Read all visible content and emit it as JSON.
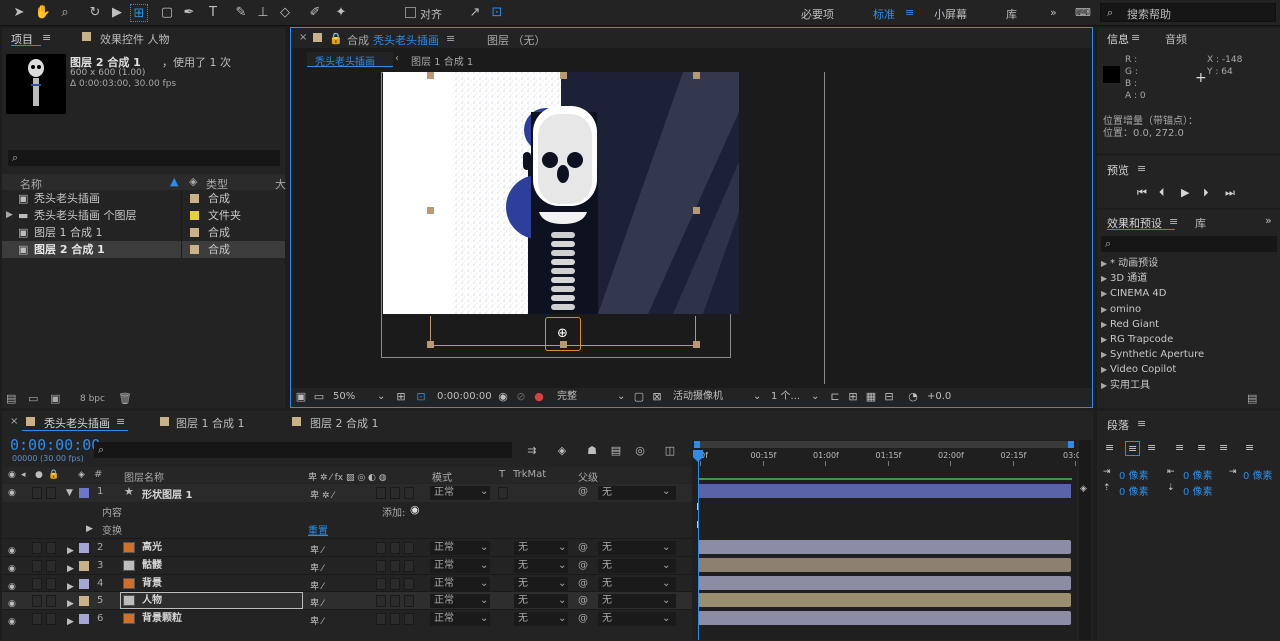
{
  "toolbar": {
    "snap_label": "对齐",
    "workspaces": [
      "必要项",
      "标准",
      "小屏幕",
      "库"
    ],
    "active_workspace": "标准",
    "search_help": "搜索帮助"
  },
  "project": {
    "tab_project": "项目",
    "tab_effects": "效果控件 人物",
    "preview_name": "图层 2 合成 1",
    "preview_used": "，使用了 1 次",
    "preview_size": "600 x 600 (1.00)",
    "preview_duration": "Δ 0:00:03:00, 30.00 fps",
    "col_name": "名称",
    "col_type": "类型",
    "col_size": "大",
    "items": [
      {
        "name": "秃头老头插画",
        "type": "合成",
        "color": "#c8b28a",
        "icon": "comp"
      },
      {
        "name": "秃头老头插画 个图层",
        "type": "文件夹",
        "color": "#e6d22d",
        "icon": "folder"
      },
      {
        "name": "图层 1 合成 1",
        "type": "合成",
        "color": "#c8b28a",
        "icon": "comp"
      },
      {
        "name": "图层 2 合成 1",
        "type": "合成",
        "color": "#c8b28a",
        "icon": "comp"
      }
    ],
    "bpc": "8 bpc"
  },
  "comp": {
    "tab_label": "合成",
    "tab_name": "秃头老头插画",
    "layer_tab": "图层 （无）",
    "crumb1": "秃头老头插画",
    "crumb2": "图层 1 合成 1",
    "zoom": "50%",
    "timecode": "0:00:00:00",
    "quality": "完整",
    "camera": "活动摄像机",
    "views": "1 个...",
    "exposure": "+0.0"
  },
  "info": {
    "tab_info": "信息",
    "tab_audio": "音频",
    "r": "R :",
    "g": "G :",
    "b": "B :",
    "a": "A : 0",
    "x": "X : -148",
    "y": "Y : 64",
    "note1": "位置增量（带锚点）：",
    "note2": "位置：0.0, 272.0"
  },
  "preview": {
    "title": "预览"
  },
  "effects": {
    "tab": "效果和预设",
    "tab2": "库",
    "items": [
      "* 动画预设",
      "3D 通道",
      "CINEMA 4D",
      "omino",
      "Red Giant",
      "RG Trapcode",
      "Synthetic Aperture",
      "Video Copilot",
      "实用工具"
    ]
  },
  "paragraph": {
    "title": "段落",
    "v1": "0 像素",
    "v2": "0 像素",
    "v3": "0 像素",
    "v4": "0 像素",
    "v5": "0 像素"
  },
  "timeline": {
    "tabs": [
      "秃头老头插画",
      "图层 1 合成 1",
      "图层 2 合成 1"
    ],
    "timecode": "0:00:00:00",
    "fps": "00000 (30.00 fps)",
    "col_num": "#",
    "col_name": "图层名称",
    "col_mode": "模式",
    "col_t": "T",
    "col_trk": "TrkMat",
    "col_parent": "父级",
    "ruler": [
      "0f",
      "00:15f",
      "01:00f",
      "01:15f",
      "02:00f",
      "02:15f",
      "03:0"
    ],
    "shape_layer": {
      "num": "1",
      "name": "形状图层 1",
      "mode": "正常",
      "parent": "无",
      "color": "#6b77c8"
    },
    "contents": "内容",
    "add": "添加:",
    "transform": "变换",
    "reset": "重置",
    "layers": [
      {
        "num": "2",
        "name": "高光",
        "mode": "正常",
        "trk": "无",
        "parent": "无",
        "color": "#a6a6d6",
        "bar": "#8c8ca5"
      },
      {
        "num": "3",
        "name": "骷髅",
        "mode": "正常",
        "trk": "无",
        "parent": "无",
        "color": "#c8b28a",
        "bar": "#8c8070"
      },
      {
        "num": "4",
        "name": "背景",
        "mode": "正常",
        "trk": "无",
        "parent": "无",
        "color": "#a6a6d6",
        "bar": "#8c8ca5"
      },
      {
        "num": "5",
        "name": "人物",
        "mode": "正常",
        "trk": "无",
        "parent": "无",
        "color": "#c8b28a",
        "bar": "#9b8e70"
      },
      {
        "num": "6",
        "name": "背景颗粒",
        "mode": "正常",
        "trk": "无",
        "parent": "无",
        "color": "#a6a6d6",
        "bar": "#8c8ca5"
      }
    ]
  }
}
